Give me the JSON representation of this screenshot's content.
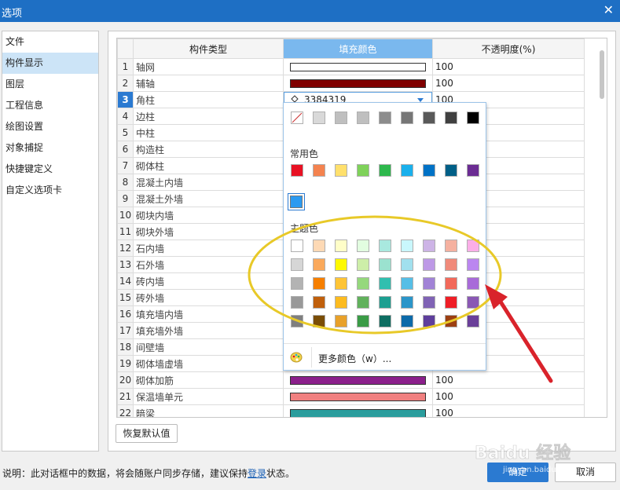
{
  "window": {
    "title": "选项"
  },
  "sidebar": {
    "items": [
      {
        "label": "文件",
        "active": false
      },
      {
        "label": "构件显示",
        "active": true
      },
      {
        "label": "图层",
        "active": false
      },
      {
        "label": "工程信息",
        "active": false
      },
      {
        "label": "绘图设置",
        "active": false
      },
      {
        "label": "对象捕捉",
        "active": false
      },
      {
        "label": "快捷键定义",
        "active": false
      },
      {
        "label": "自定义选项卡",
        "active": false
      }
    ]
  },
  "table": {
    "columns": [
      "构件类型",
      "填充颜色",
      "不透明度(%)"
    ],
    "highlighted_column": 1,
    "current_row": 3,
    "current_color_value": "3384319",
    "rows": [
      {
        "num": "1",
        "type": "轴网",
        "color": "#ffffff",
        "opacity": "100"
      },
      {
        "num": "2",
        "type": "辅轴",
        "color": "#800000",
        "opacity": "100"
      },
      {
        "num": "3",
        "type": "角柱",
        "color": "#33a2ff",
        "opacity": "100"
      },
      {
        "num": "4",
        "type": "边柱",
        "color": "",
        "opacity": ""
      },
      {
        "num": "5",
        "type": "中柱",
        "color": "",
        "opacity": ""
      },
      {
        "num": "6",
        "type": "构造柱",
        "color": "",
        "opacity": ""
      },
      {
        "num": "7",
        "type": "砌体柱",
        "color": "",
        "opacity": ""
      },
      {
        "num": "8",
        "type": "混凝土内墙",
        "color": "",
        "opacity": ""
      },
      {
        "num": "9",
        "type": "混凝土外墙",
        "color": "",
        "opacity": ""
      },
      {
        "num": "10",
        "type": "砌块内墙",
        "color": "",
        "opacity": ""
      },
      {
        "num": "11",
        "type": "砌块外墙",
        "color": "",
        "opacity": ""
      },
      {
        "num": "12",
        "type": "石内墙",
        "color": "",
        "opacity": ""
      },
      {
        "num": "13",
        "type": "石外墙",
        "color": "",
        "opacity": ""
      },
      {
        "num": "14",
        "type": "砖内墙",
        "color": "",
        "opacity": ""
      },
      {
        "num": "15",
        "type": "砖外墙",
        "color": "",
        "opacity": ""
      },
      {
        "num": "16",
        "type": "填充墙内墙",
        "color": "",
        "opacity": ""
      },
      {
        "num": "17",
        "type": "填充墙外墙",
        "color": "",
        "opacity": ""
      },
      {
        "num": "18",
        "type": "间壁墙",
        "color": "",
        "opacity": ""
      },
      {
        "num": "19",
        "type": "砌体墙虚墙",
        "color": "",
        "opacity": ""
      },
      {
        "num": "20",
        "type": "砌体加筋",
        "color": "#8b1f8b",
        "opacity": "100"
      },
      {
        "num": "21",
        "type": "保温墙单元",
        "color": "#f08080",
        "opacity": "100"
      },
      {
        "num": "22",
        "type": "暗梁",
        "color": "#2a9d9d",
        "opacity": "100"
      }
    ]
  },
  "color_picker": {
    "standard_colors": [
      "none",
      "#d9d9d9",
      "#bfbfbf",
      "#bfbfbf",
      "#8c8c8c",
      "#767676",
      "#595959",
      "#404040",
      "#000000"
    ],
    "common_label": "常用色",
    "common_colors": [
      "#e81123",
      "#f4834f",
      "#ffe06c",
      "#7fd25a",
      "#2eb84d",
      "#1ab0ec",
      "#0072c6",
      "#005f87",
      "#6b2c93"
    ],
    "recent_color": "#2b9af0",
    "theme_label": "主题色",
    "theme_rows": [
      [
        "#ffffff",
        "#fdd9b5",
        "#fffec8",
        "#e2fde0",
        "#a9e9df",
        "#c9f7fd",
        "#cdb4e6",
        "#f5b1a0",
        "#fbaee8"
      ],
      [
        "#d6d6d6",
        "#faa95c",
        "#fef900",
        "#cdeea8",
        "#9be2cf",
        "#a1e0ee",
        "#bd99e6",
        "#f08a7a",
        "#bb86f0"
      ],
      [
        "#b3b3b3",
        "#f67f00",
        "#fec435",
        "#95d87c",
        "#31bfaf",
        "#56bee6",
        "#a183d6",
        "#f2695a",
        "#a86bd9"
      ],
      [
        "#999999",
        "#c0600c",
        "#fdbb1f",
        "#61b15c",
        "#1c9f91",
        "#2b95c9",
        "#8063b5",
        "#ef1e26",
        "#8a58b4"
      ],
      [
        "#7f7f7f",
        "#7a4d05",
        "#e8a12a",
        "#3a9b46",
        "#0e6e62",
        "#0c6aa9",
        "#5e3e9c",
        "#9c3f12",
        "#6a3f99"
      ]
    ],
    "more_colors_label": "更多颜色（w）..."
  },
  "buttons": {
    "reset": "恢复默认值",
    "ok": "确定",
    "cancel": "取消"
  },
  "footer": {
    "prefix": "说明：此对话框中的数据，将会随账户同步存储，建议保持",
    "link": "登录",
    "suffix": "状态。"
  },
  "watermark": {
    "text": "Baidu 经验",
    "sub": "jingyan.baidu.com"
  },
  "annotation_colors": {
    "ellipse": "#e8c928",
    "arrow": "#d9232b"
  }
}
